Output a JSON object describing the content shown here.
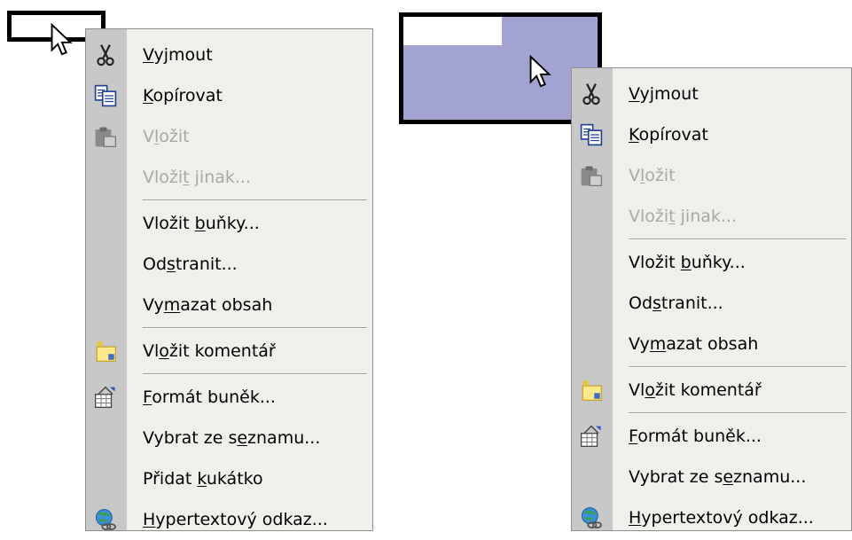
{
  "left_menu": {
    "items": [
      {
        "pre": "",
        "u": "V",
        "post": "yjmout",
        "icon": "scissors-icon",
        "disabled": false
      },
      {
        "pre": "",
        "u": "K",
        "post": "opírovat",
        "icon": "copy-icon",
        "disabled": false
      },
      {
        "pre": "V",
        "u": "l",
        "post": "ožit",
        "icon": "paste-icon",
        "disabled": true
      },
      {
        "pre": "Vloži",
        "u": "t",
        "post": " jinak...",
        "icon": "",
        "disabled": true
      },
      {
        "sep": true
      },
      {
        "pre": "Vložit ",
        "u": "b",
        "post": "uňky...",
        "icon": "",
        "disabled": false
      },
      {
        "pre": "Od",
        "u": "s",
        "post": "tranit...",
        "icon": "",
        "disabled": false
      },
      {
        "pre": "Vy",
        "u": "m",
        "post": "azat obsah",
        "icon": "",
        "disabled": false
      },
      {
        "sep": true
      },
      {
        "pre": "Vl",
        "u": "o",
        "post": "žit komentář",
        "icon": "comment-icon",
        "disabled": false
      },
      {
        "sep": true
      },
      {
        "pre": "",
        "u": "F",
        "post": "ormát buněk...",
        "icon": "format-cells-icon",
        "disabled": false
      },
      {
        "pre": "Vybrat ze s",
        "u": "e",
        "post": "znamu...",
        "icon": "",
        "disabled": false
      },
      {
        "pre": "Přidat ",
        "u": "k",
        "post": "ukátko",
        "icon": "",
        "disabled": false
      },
      {
        "pre": "",
        "u": "H",
        "post": "ypertextový odkaz...",
        "icon": "hyperlink-icon",
        "disabled": false
      }
    ]
  },
  "right_menu": {
    "items": [
      {
        "pre": "",
        "u": "V",
        "post": "yjmout",
        "icon": "scissors-icon",
        "disabled": false
      },
      {
        "pre": "",
        "u": "K",
        "post": "opírovat",
        "icon": "copy-icon",
        "disabled": false
      },
      {
        "pre": "V",
        "u": "l",
        "post": "ožit",
        "icon": "paste-icon",
        "disabled": true
      },
      {
        "pre": "Vloži",
        "u": "t",
        "post": " jinak...",
        "icon": "",
        "disabled": true
      },
      {
        "sep": true
      },
      {
        "pre": "Vložit ",
        "u": "b",
        "post": "uňky...",
        "icon": "",
        "disabled": false
      },
      {
        "pre": "Od",
        "u": "s",
        "post": "tranit...",
        "icon": "",
        "disabled": false
      },
      {
        "pre": "Vy",
        "u": "m",
        "post": "azat obsah",
        "icon": "",
        "disabled": false
      },
      {
        "sep": true
      },
      {
        "pre": "Vl",
        "u": "o",
        "post": "žit komentář",
        "icon": "comment-icon",
        "disabled": false
      },
      {
        "sep": true
      },
      {
        "pre": "",
        "u": "F",
        "post": "ormát buněk...",
        "icon": "format-cells-icon",
        "disabled": false
      },
      {
        "pre": "Vybrat ze s",
        "u": "e",
        "post": "znamu...",
        "icon": "",
        "disabled": false
      },
      {
        "pre": "",
        "u": "H",
        "post": "ypertextový odkaz...",
        "icon": "hyperlink-icon",
        "disabled": false
      }
    ]
  },
  "colors": {
    "selection_fill": "#a3a3d2",
    "menu_bg": "#f1efeb",
    "gutter_bg": "#c8c8c8",
    "disabled_text": "#a8a8a8"
  }
}
